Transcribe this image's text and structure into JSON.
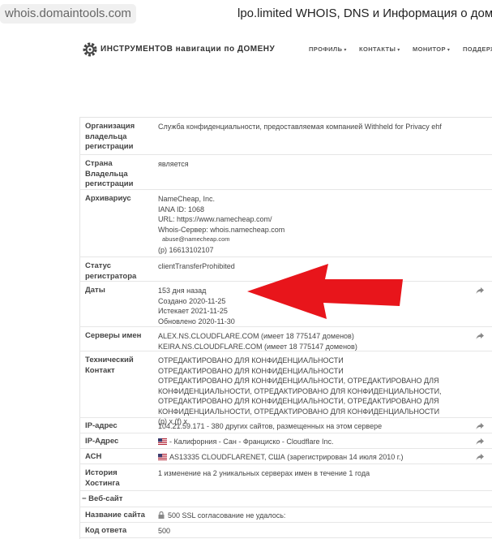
{
  "browser": {
    "url": "whois.domaintools.com",
    "tab_title": "lpo.limited WHOIS, DNS и Информация о домене"
  },
  "header": {
    "logo_text": "ИНСТРУМЕНТОВ навигации по ДОМЕНУ",
    "nav": [
      "ПРОФИЛЬ",
      "КОНТАКТЫ",
      "МОНИТОР",
      "ПОДДЕРЖКА"
    ]
  },
  "rows": {
    "org": {
      "label": "Организация владельца регистрации",
      "value": "Служба конфиденциальности, предоставляемая компанией Withheld for Privacy ehf"
    },
    "country": {
      "label": "Страна Владельца регистрации",
      "value": "является"
    },
    "registrar": {
      "label": "Архивариус",
      "lines": [
        "NameCheap, Inc.",
        "IANA ID: 1068",
        "URL: https://www.namecheap.com/",
        "Whois-Сервер: whois.namecheap.com"
      ],
      "email": "abuse@namecheap.com",
      "phone": "(p) 16613102107"
    },
    "status": {
      "label": "Статус регистратора",
      "value": "clientTransferProhibited"
    },
    "dates": {
      "label": "Даты",
      "lines": [
        "153 дня назад",
        "Создано 2020-11-25",
        "Истекает 2021-11-25",
        "Обновлено 2020-11-30"
      ]
    },
    "nameservers": {
      "label": "Серверы имен",
      "lines": [
        "ALEX.NS.CLOUDFLARE.COM (имеет 18 775147 доменов)",
        "KEIRA.NS.CLOUDFLARE.COM (имеет 18 775147 доменов)"
      ]
    },
    "tech": {
      "label": "Технический Контакт",
      "lines": [
        "ОТРЕДАКТИРОВАНО ДЛЯ КОНФИДЕНЦИАЛЬНОСТИ",
        "ОТРЕДАКТИРОВАНО ДЛЯ КОНФИДЕНЦИАЛЬНОСТИ",
        "ОТРЕДАКТИРОВАНО ДЛЯ КОНФИДЕНЦИАЛЬНОСТИ, ОТРЕДАКТИРОВАНО ДЛЯ",
        "КОНФИДЕНЦИАЛЬНОСТИ, ОТРЕДАКТИРОВАНО ДЛЯ КОНФИДЕНЦИАЛЬНОСТИ,",
        "ОТРЕДАКТИРОВАНО ДЛЯ КОНФИДЕНЦИАЛЬНОСТИ, ОТРЕДАКТИРОВАНО ДЛЯ",
        "КОНФИДЕНЦИАЛЬНОСТИ, ОТРЕДАКТИРОВАНО ДЛЯ КОНФИДЕНЦИАЛЬНОСТИ",
        "(p) x  (f) x"
      ]
    },
    "ip": {
      "label": "IP-адрес",
      "value": "104.21.59.171 - 380 других сайтов, размещенных на этом сервере"
    },
    "ip_location": {
      "label": "IP-Адрес",
      "value": "- Калифорния - Сан - Франциско - Cloudflare Inc."
    },
    "asn": {
      "label": "АСН",
      "value": "AS13335 CLOUDFLARENET, США (зарегистрирован 14 июля 2010 г.)"
    },
    "hosting": {
      "label": "История Хостинга",
      "value": "1 изменение на 2 уникальных серверах имен в течение 1 года"
    }
  },
  "website_section": {
    "title": "− Веб-сайт"
  },
  "site_rows": {
    "site_name": {
      "label": "Название сайта",
      "value": "500 SSL согласование не удалось:"
    },
    "response_code": {
      "label": "Код ответа",
      "value": "500"
    }
  },
  "colors": {
    "arrow": "#e8151b",
    "flag_red": "#b22234",
    "flag_blue": "#3c3b6e"
  }
}
